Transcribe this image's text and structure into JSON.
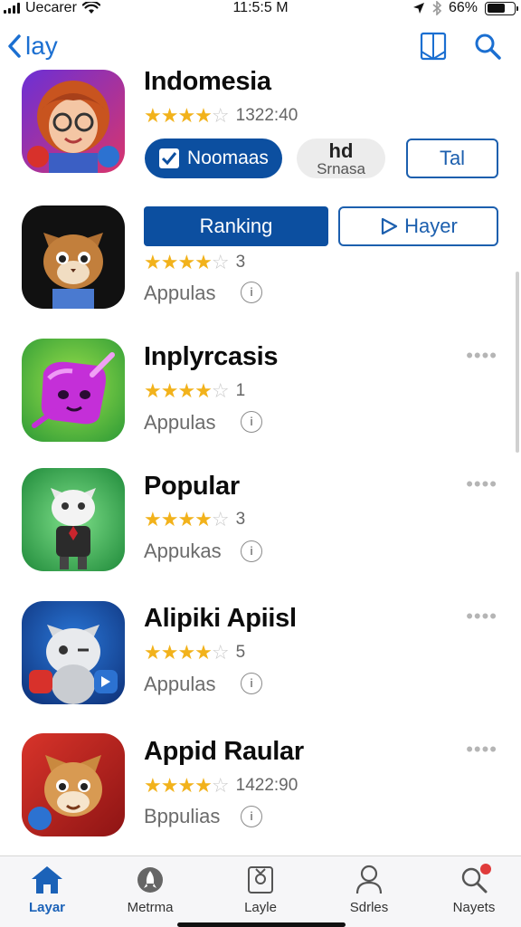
{
  "status_bar": {
    "carrier": "Uecarer",
    "time": "11:5:5 M",
    "battery": "66%",
    "battery_level": 0.66
  },
  "nav": {
    "back_label": "lay",
    "icons": [
      "book-icon",
      "search-icon"
    ]
  },
  "rows": [
    {
      "title": "Indomesia",
      "stars": 4.5,
      "rating_count": "1322:40",
      "primary_pill": "Noomaas",
      "secondary_pill_top": "hd",
      "secondary_pill_bottom": "Srnasa",
      "outline_button": "Tal"
    },
    {
      "ranking_button": "Ranking",
      "player_button": "Hayer",
      "stars": 4.5,
      "rating_count": "3",
      "category": "Appulas",
      "info": "i"
    },
    {
      "title": "Inplyrcasis",
      "stars": 4.5,
      "rating_count": "1",
      "category": "Appulas",
      "info": "i",
      "more": "••••"
    },
    {
      "title": "Popular",
      "stars": 4.5,
      "rating_count": "3",
      "category": "Appukas",
      "info": "i",
      "more": "••••"
    },
    {
      "title": "Alipiki Apiisl",
      "stars": 4.5,
      "rating_count": "5",
      "category": "Appulas",
      "info": "i",
      "more": "••••"
    },
    {
      "title": "Appid Raular",
      "stars": 4.5,
      "rating_count": "1422:90",
      "category": "Bppulias",
      "info": "i",
      "more": "••••"
    }
  ],
  "tab_bar": {
    "tabs": [
      {
        "label": "Layar",
        "icon": "home-icon",
        "active": true
      },
      {
        "label": "Metrma",
        "icon": "rocket-icon",
        "active": false
      },
      {
        "label": "Layle",
        "icon": "game-icon",
        "active": false
      },
      {
        "label": "Sdrles",
        "icon": "person-icon",
        "active": false
      },
      {
        "label": "Nayets",
        "icon": "search-icon",
        "active": false
      }
    ]
  },
  "colors": {
    "accent": "#1b6fd1",
    "primary_button": "#0c4fa0",
    "star": "#f2b21b"
  }
}
